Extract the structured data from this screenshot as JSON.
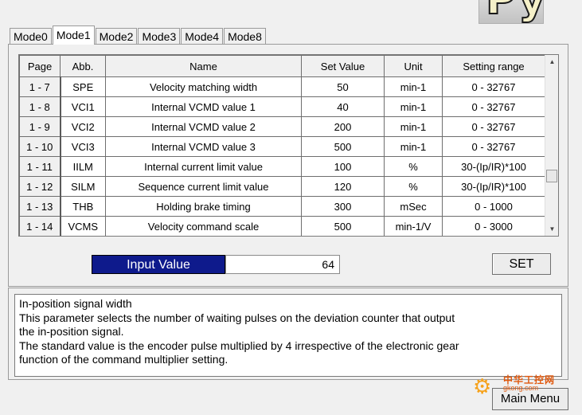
{
  "logo": {
    "text": "Py"
  },
  "tabs": [
    {
      "label": "Mode0",
      "active": false
    },
    {
      "label": "Mode1",
      "active": true
    },
    {
      "label": "Mode2",
      "active": false
    },
    {
      "label": "Mode3",
      "active": false
    },
    {
      "label": "Mode4",
      "active": false
    },
    {
      "label": "Mode8",
      "active": false
    }
  ],
  "table": {
    "headers": [
      "Page",
      "Abb.",
      "Name",
      "Set Value",
      "Unit",
      "Setting range"
    ],
    "rows": [
      [
        "1 - 7",
        "SPE",
        "Velocity matching width",
        "50",
        "min-1",
        "0 - 32767"
      ],
      [
        "1 - 8",
        "VCI1",
        "Internal VCMD value 1",
        "40",
        "min-1",
        "0 - 32767"
      ],
      [
        "1 - 9",
        "VCI2",
        "Internal VCMD value 2",
        "200",
        "min-1",
        "0 - 32767"
      ],
      [
        "1 - 10",
        "VCI3",
        "Internal VCMD value 3",
        "500",
        "min-1",
        "0 - 32767"
      ],
      [
        "1 - 11",
        "IILM",
        "Internal current limit value",
        "100",
        "%",
        "30-(Ip/IR)*100"
      ],
      [
        "1 - 12",
        "SILM",
        "Sequence current limit value",
        "120",
        "%",
        "30-(Ip/IR)*100"
      ],
      [
        "1 - 13",
        "THB",
        "Holding brake timing",
        "300",
        "mSec",
        "0 - 1000"
      ],
      [
        "1 - 14",
        "VCMS",
        "Velocity command scale",
        "500",
        "min-1/V",
        "0 - 3000"
      ]
    ]
  },
  "input": {
    "label": "Input Value",
    "value": "64"
  },
  "set_button": "SET",
  "description": {
    "lines": [
      "In-position signal width",
      "This parameter selects the number of waiting pulses on the deviation counter that output",
      "the in-position signal.",
      "The standard value is the encoder pulse multiplied by 4 irrespective of the electronic gear",
      "function of the command multiplier setting."
    ]
  },
  "main_menu_button": "Main Menu",
  "watermark": {
    "cn": "中华工控网",
    "url": "gkong.com"
  },
  "colors": {
    "input_label_bg": "#0e1a8c",
    "watermark": "#e05a10"
  }
}
